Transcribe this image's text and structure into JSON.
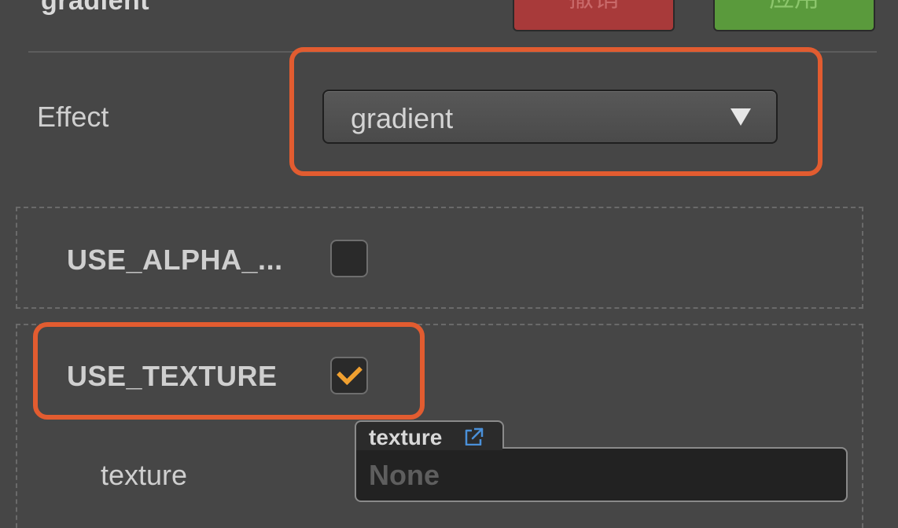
{
  "header": {
    "title": "gradient",
    "revert_label": "撤销",
    "apply_label": "应用"
  },
  "effect": {
    "label": "Effect",
    "selected": "gradient"
  },
  "defines": [
    {
      "label": "USE_ALPHA_...",
      "checked": false
    },
    {
      "label": "USE_TEXTURE",
      "checked": true
    }
  ],
  "texture": {
    "label": "texture",
    "asset_type": "texture",
    "value": "None"
  },
  "colors": {
    "highlight": "#e25c30",
    "checkmark": "#f0a030",
    "link_icon": "#4a90d9",
    "revert_button": "#a83a3a",
    "apply_button": "#5a9a3c"
  }
}
